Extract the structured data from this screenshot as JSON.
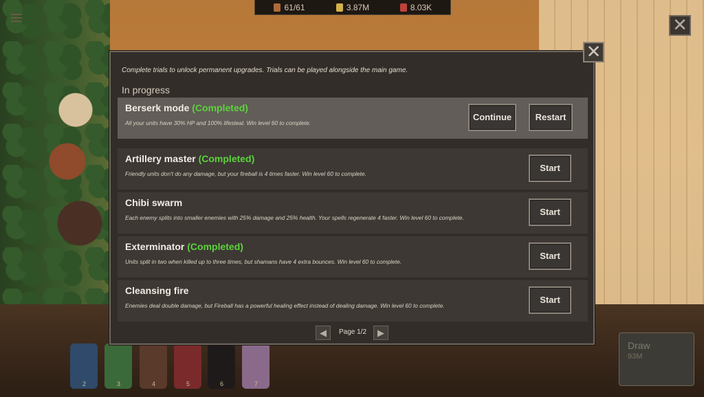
{
  "hud": {
    "units": "61/61",
    "gold": "3.87M",
    "gems": "8.03K"
  },
  "dialog": {
    "intro": "Complete trials to unlock permanent upgrades. Trials can be played alongside the main game.",
    "section_title": "In progress",
    "trials": [
      {
        "name": "Berserk mode",
        "status": "(Completed)",
        "description": "All your units have 30% HP and 100% lifesteal. Win level 60 to complete.",
        "buttons": [
          "Continue",
          "Restart"
        ]
      },
      {
        "name": "Artillery master",
        "status": "(Completed)",
        "description": "Friendly units don't do any damage, but your fireball is 4 times faster. Win level 60 to complete.",
        "buttons": [
          "Start"
        ]
      },
      {
        "name": "Chibi swarm",
        "status": "",
        "description": "Each enemy splits into smaller enemies with 25% damage and 25% health. Your spells regenerate 4 faster. Win level 60 to complete.",
        "buttons": [
          "Start"
        ]
      },
      {
        "name": "Exterminator",
        "status": "(Completed)",
        "description": "Units split in two when killed up to three times, but shamans have 4 extra bounces. Win level 60 to complete.",
        "buttons": [
          "Start"
        ]
      },
      {
        "name": "Cleansing fire",
        "status": "",
        "description": "Enemies deal double damage, but Fireball has a powerful healing effect instead of dealing damage. Win level 60 to complete.",
        "buttons": [
          "Start"
        ]
      }
    ],
    "page_label": "Page 1/2",
    "close_glyph": "✕",
    "prev_glyph": "◀",
    "next_glyph": "▶"
  },
  "draw_card": {
    "label": "Draw",
    "cost": "93M"
  },
  "unit_bar": {
    "slots": [
      "2",
      "3",
      "4",
      "5",
      "6",
      "7"
    ]
  },
  "colors": {
    "completed": "#5cd33b",
    "dialog_bg": "#322d29",
    "row_active": "#625d58"
  },
  "icons": [
    "menu-icon",
    "close-icon",
    "prev-page-icon",
    "next-page-icon",
    "unit-count-icon",
    "gold-icon",
    "gem-icon"
  ]
}
